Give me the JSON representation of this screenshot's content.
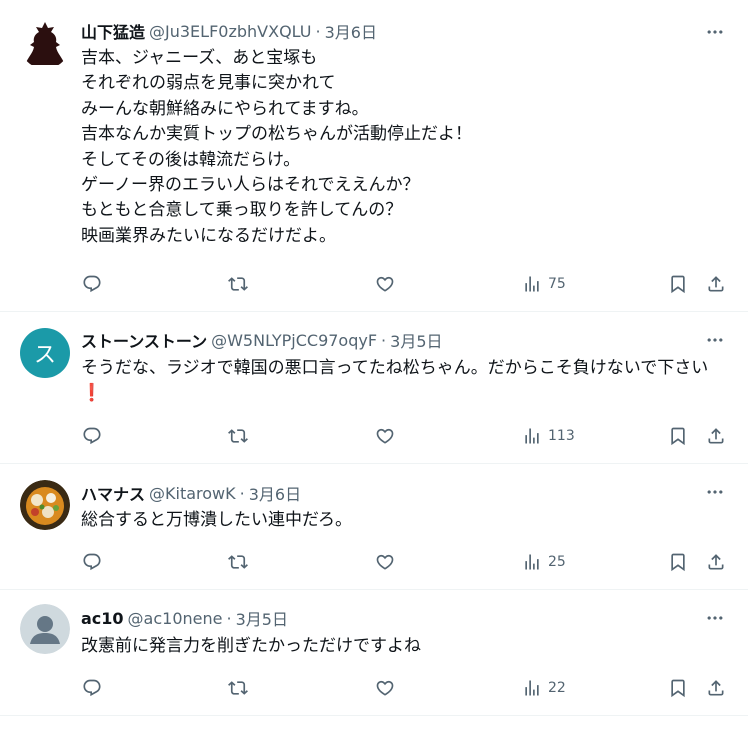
{
  "tweets": [
    {
      "name": "山下猛造",
      "handle": "@Ju3ELF0zbhVXQLU",
      "date": "3月6日",
      "avatar_icon": "samurai-silhouette-icon",
      "lines": [
        "吉本、ジャニーズ、あと宝塚も",
        "それぞれの弱点を見事に突かれて",
        "みーんな朝鮮絡みにやられてますね。",
        "吉本なんか実質トップの松ちゃんが活動停止だよ！",
        "そしてその後は韓流だらけ。",
        "ゲーノー界のエラい人らはそれでええんか？",
        "もともと合意して乗っ取りを許してんの？",
        "映画業界みたいになるだけだよ。"
      ],
      "views": "75"
    },
    {
      "name": "ストーンストーン",
      "handle": "@W5NLYPjCC97oqyF",
      "date": "3月5日",
      "avatar_letter": "ス",
      "avatar_color": "#1b9aa8",
      "text": "そうだな、ラジオで韓国の悪口言ってたね松ちゃん。だからこそ負けないで下さい",
      "emoji": "❗",
      "views": "113"
    },
    {
      "name": "ハマナス",
      "handle": "@KitarowK",
      "date": "3月6日",
      "avatar_icon": "food-photo-icon",
      "text": "総合すると万博潰したい連中だろ。",
      "views": "25"
    },
    {
      "name": "ac10",
      "handle": "@ac10nene",
      "date": "3月5日",
      "avatar_icon": "default-user-icon",
      "text": "改憲前に発言力を削ぎたかっただけですよね",
      "views": "22"
    }
  ],
  "separator": "·",
  "colors": {
    "text": "#0f1419",
    "muted": "#536471",
    "border": "#eff3f4"
  }
}
